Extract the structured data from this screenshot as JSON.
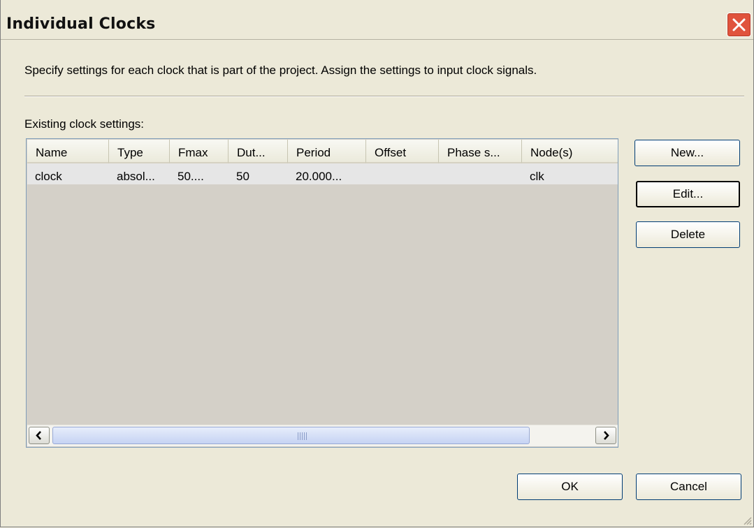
{
  "window": {
    "title": "Individual Clocks",
    "close_icon": "close-icon"
  },
  "intro_text": "Specify settings for each clock that is part of the project. Assign the settings to input clock signals.",
  "list": {
    "label": "Existing clock settings:",
    "columns": [
      "Name",
      "Type",
      "Fmax",
      "Dut...",
      "Period",
      "Offset",
      "Phase s...",
      "Node(s)"
    ],
    "rows": [
      [
        "clock",
        "absol...",
        "50....",
        "50",
        "20.000...",
        "",
        "",
        "clk"
      ]
    ],
    "scrollbar": {
      "left_icon": "chevron-left-icon",
      "right_icon": "chevron-right-icon",
      "thumb_fraction": 0.87
    }
  },
  "side_buttons": {
    "new": "New...",
    "edit": "Edit...",
    "delete": "Delete"
  },
  "footer_buttons": {
    "ok": "OK",
    "cancel": "Cancel"
  },
  "colors": {
    "dialog_bg": "#ece9d8",
    "close_button": "#e0533d",
    "list_border": "#7f9db9",
    "scroll_thumb": "#c6d3f3"
  }
}
